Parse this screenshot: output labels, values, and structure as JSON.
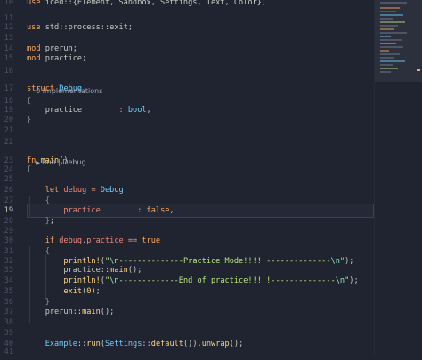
{
  "editor": {
    "lines": [
      {
        "ln": "10",
        "tokens": [
          [
            "kw",
            "use "
          ],
          [
            "pn",
            "iced::{Element, Sandbox, Settings, Text, Color};"
          ]
        ]
      },
      {
        "ln": "11",
        "tokens": []
      },
      {
        "ln": "12",
        "tokens": [
          [
            "kw",
            "use "
          ],
          [
            "pn",
            "std::process::exit;"
          ]
        ]
      },
      {
        "ln": "13",
        "tokens": []
      },
      {
        "ln": "14",
        "tokens": [
          [
            "kw",
            "mod "
          ],
          [
            "pn",
            "prerun;"
          ]
        ]
      },
      {
        "ln": "15",
        "tokens": [
          [
            "kw",
            "mod "
          ],
          [
            "pn",
            "practice;"
          ]
        ]
      },
      {
        "ln": "16",
        "tokens": []
      },
      {
        "ln": "17",
        "tokens": [
          [
            "kw",
            "struct "
          ],
          [
            "ty",
            "Debug"
          ]
        ]
      },
      {
        "ln": "18",
        "tokens": [
          [
            "br",
            "{"
          ]
        ]
      },
      {
        "ln": "19",
        "tokens": [
          [
            "pn",
            "    practice        "
          ],
          [
            "op",
            ": "
          ],
          [
            "ty",
            "bool"
          ],
          [
            "pn",
            ","
          ]
        ]
      },
      {
        "ln": "20",
        "tokens": [
          [
            "br",
            "}"
          ]
        ]
      },
      {
        "ln": "21",
        "tokens": []
      },
      {
        "ln": "22",
        "tokens": []
      },
      {
        "ln": "23",
        "tokens": [
          [
            "kw",
            "fn "
          ],
          [
            "fn",
            "main"
          ],
          [
            "pn",
            "()"
          ]
        ]
      },
      {
        "ln": "24",
        "tokens": [
          [
            "br",
            "{"
          ]
        ]
      },
      {
        "ln": "25",
        "tokens": []
      },
      {
        "ln": "26",
        "tokens": [
          [
            "kw",
            "    let "
          ],
          [
            "fld",
            "debug "
          ],
          [
            "op",
            "= "
          ],
          [
            "ty",
            "Debug"
          ]
        ]
      },
      {
        "ln": "27",
        "tokens": [
          [
            "br",
            "    {"
          ]
        ]
      },
      {
        "ln": "19",
        "tokens": [
          [
            "fld",
            "        practice        "
          ],
          [
            "op",
            ": "
          ],
          [
            "kw",
            "false"
          ],
          [
            "pn",
            ","
          ]
        ]
      },
      {
        "ln": "28",
        "tokens": [
          [
            "br",
            "    }"
          ],
          [
            "pn",
            ";"
          ]
        ]
      },
      {
        "ln": "29",
        "tokens": []
      },
      {
        "ln": "30",
        "tokens": [
          [
            "kw",
            "    if "
          ],
          [
            "fld",
            "debug"
          ],
          [
            "pn",
            "."
          ],
          [
            "fld",
            "practice "
          ],
          [
            "op",
            "== "
          ],
          [
            "kw",
            "true"
          ]
        ]
      },
      {
        "ln": "31",
        "tokens": [
          [
            "br",
            "    {"
          ]
        ]
      },
      {
        "ln": "32",
        "tokens": [
          [
            "fn",
            "        println!"
          ],
          [
            "pn",
            "("
          ],
          [
            "str",
            "\""
          ],
          [
            "esc",
            "\\n"
          ],
          [
            "str",
            "--------------Practice Mode!!!!!--------------"
          ],
          [
            "esc",
            "\\n"
          ],
          [
            "str",
            "\""
          ],
          [
            "pn",
            ");"
          ]
        ]
      },
      {
        "ln": "33",
        "tokens": [
          [
            "pn",
            "        practice::"
          ],
          [
            "fn",
            "main"
          ],
          [
            "pn",
            "();"
          ]
        ]
      },
      {
        "ln": "34",
        "tokens": [
          [
            "fn",
            "        println!"
          ],
          [
            "pn",
            "("
          ],
          [
            "str",
            "\""
          ],
          [
            "esc",
            "\\n"
          ],
          [
            "str",
            "-------------End of practice!!!!!--------------"
          ],
          [
            "esc",
            "\\n"
          ],
          [
            "str",
            "\""
          ],
          [
            "pn",
            ");"
          ]
        ]
      },
      {
        "ln": "35",
        "tokens": [
          [
            "fn",
            "        exit"
          ],
          [
            "pn",
            "("
          ],
          [
            "num",
            "0"
          ],
          [
            "pn",
            ");"
          ]
        ]
      },
      {
        "ln": "36",
        "tokens": [
          [
            "br",
            "    }"
          ]
        ]
      },
      {
        "ln": "37",
        "tokens": [
          [
            "pn",
            "    prerun::"
          ],
          [
            "fn",
            "main"
          ],
          [
            "pn",
            "();"
          ]
        ]
      },
      {
        "ln": "38",
        "tokens": []
      },
      {
        "ln": "39",
        "tokens": []
      },
      {
        "ln": "40",
        "tokens": [
          [
            "ty",
            "    Example"
          ],
          [
            "pn",
            "::"
          ],
          [
            "fn",
            "run"
          ],
          [
            "pn",
            "("
          ],
          [
            "ty",
            "Settings"
          ],
          [
            "pn",
            "::"
          ],
          [
            "fn",
            "default"
          ],
          [
            "pn",
            "())."
          ],
          [
            "fn",
            "unwrap"
          ],
          [
            "pn",
            "();"
          ]
        ]
      },
      {
        "ln": "41",
        "tokens": []
      }
    ],
    "codelens": {
      "implementations": "0 implementations",
      "run": "Run",
      "separator": " | ",
      "debug": "Debug"
    }
  },
  "colors": {
    "background": "#1f2430",
    "keyword": "#ffa759",
    "type": "#73d0ff",
    "function": "#ffd580",
    "variable": "#f28779",
    "string": "#bae67e"
  }
}
